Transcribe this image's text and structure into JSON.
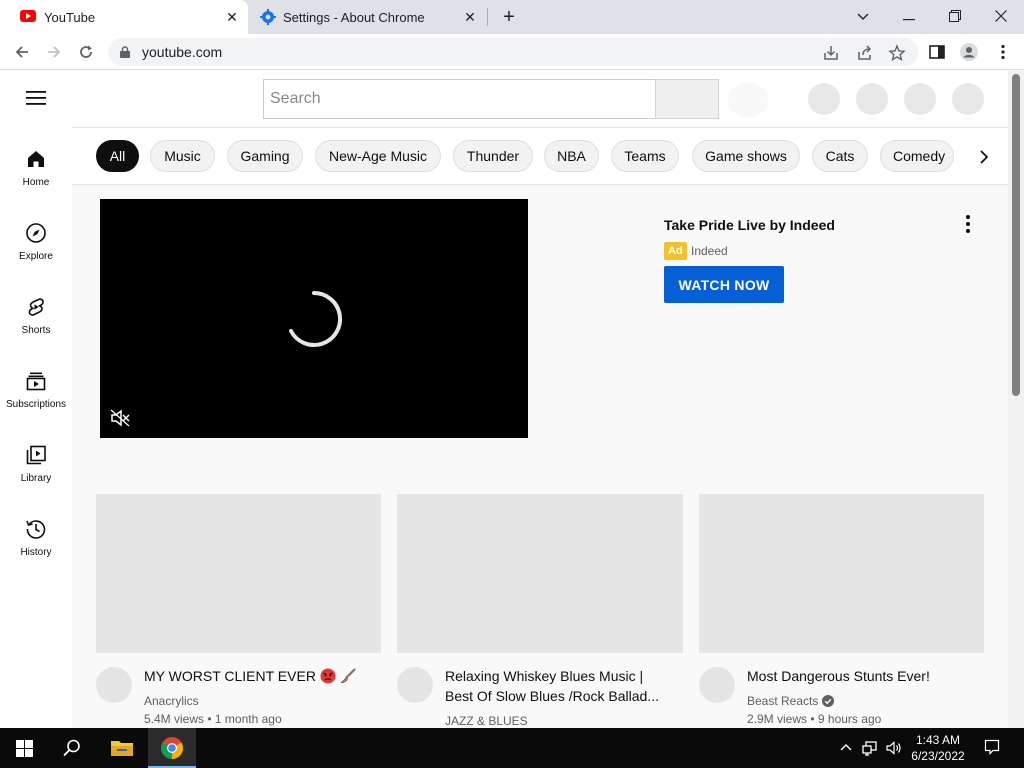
{
  "browser": {
    "tabs": [
      {
        "title": "YouTube",
        "favicon": "youtube-favicon",
        "active": true
      },
      {
        "title": "Settings - About Chrome",
        "favicon": "settings-gear-favicon",
        "active": false
      }
    ],
    "url": "youtube.com"
  },
  "youtube": {
    "search_placeholder": "Search",
    "guide": [
      {
        "label": "Home",
        "icon": "home-icon"
      },
      {
        "label": "Explore",
        "icon": "compass-icon"
      },
      {
        "label": "Shorts",
        "icon": "shorts-icon"
      },
      {
        "label": "Subscriptions",
        "icon": "subscriptions-icon"
      },
      {
        "label": "Library",
        "icon": "library-icon"
      },
      {
        "label": "History",
        "icon": "history-icon"
      }
    ],
    "chips": [
      {
        "label": "All",
        "selected": true
      },
      {
        "label": "Music"
      },
      {
        "label": "Gaming"
      },
      {
        "label": "New-Age Music"
      },
      {
        "label": "Thunder"
      },
      {
        "label": "NBA"
      },
      {
        "label": "Teams"
      },
      {
        "label": "Game shows"
      },
      {
        "label": "Cats"
      },
      {
        "label": "Comedy"
      }
    ],
    "ad": {
      "title": "Take Pride Live by Indeed",
      "badge": "Ad",
      "advertiser": "Indeed",
      "cta": "WATCH NOW"
    },
    "videos": [
      {
        "title": "MY WORST CLIENT EVER",
        "emojis": [
          "angry-face-emoji",
          "paintbrush-emoji"
        ],
        "channel": "Anacrylics",
        "views": "5.4M views",
        "age": "1 month ago",
        "verified": false
      },
      {
        "title": "Relaxing Whiskey Blues Music | Best Of Slow Blues /Rock Ballad...",
        "emojis": [],
        "channel": "JAZZ & BLUES",
        "views": "",
        "age": "",
        "verified": false
      },
      {
        "title": "Most Dangerous Stunts Ever!",
        "emojis": [],
        "channel": "Beast Reacts",
        "views": "2.9M views",
        "age": "9 hours ago",
        "verified": true
      }
    ]
  },
  "taskbar": {
    "time": "1:43 AM",
    "date": "6/23/2022"
  },
  "colors": {
    "youtube_red": "#ff0000",
    "cta_blue": "#065fd4",
    "ad_badge": "#f2c12e",
    "chip_selected": "#0f0f0f"
  }
}
